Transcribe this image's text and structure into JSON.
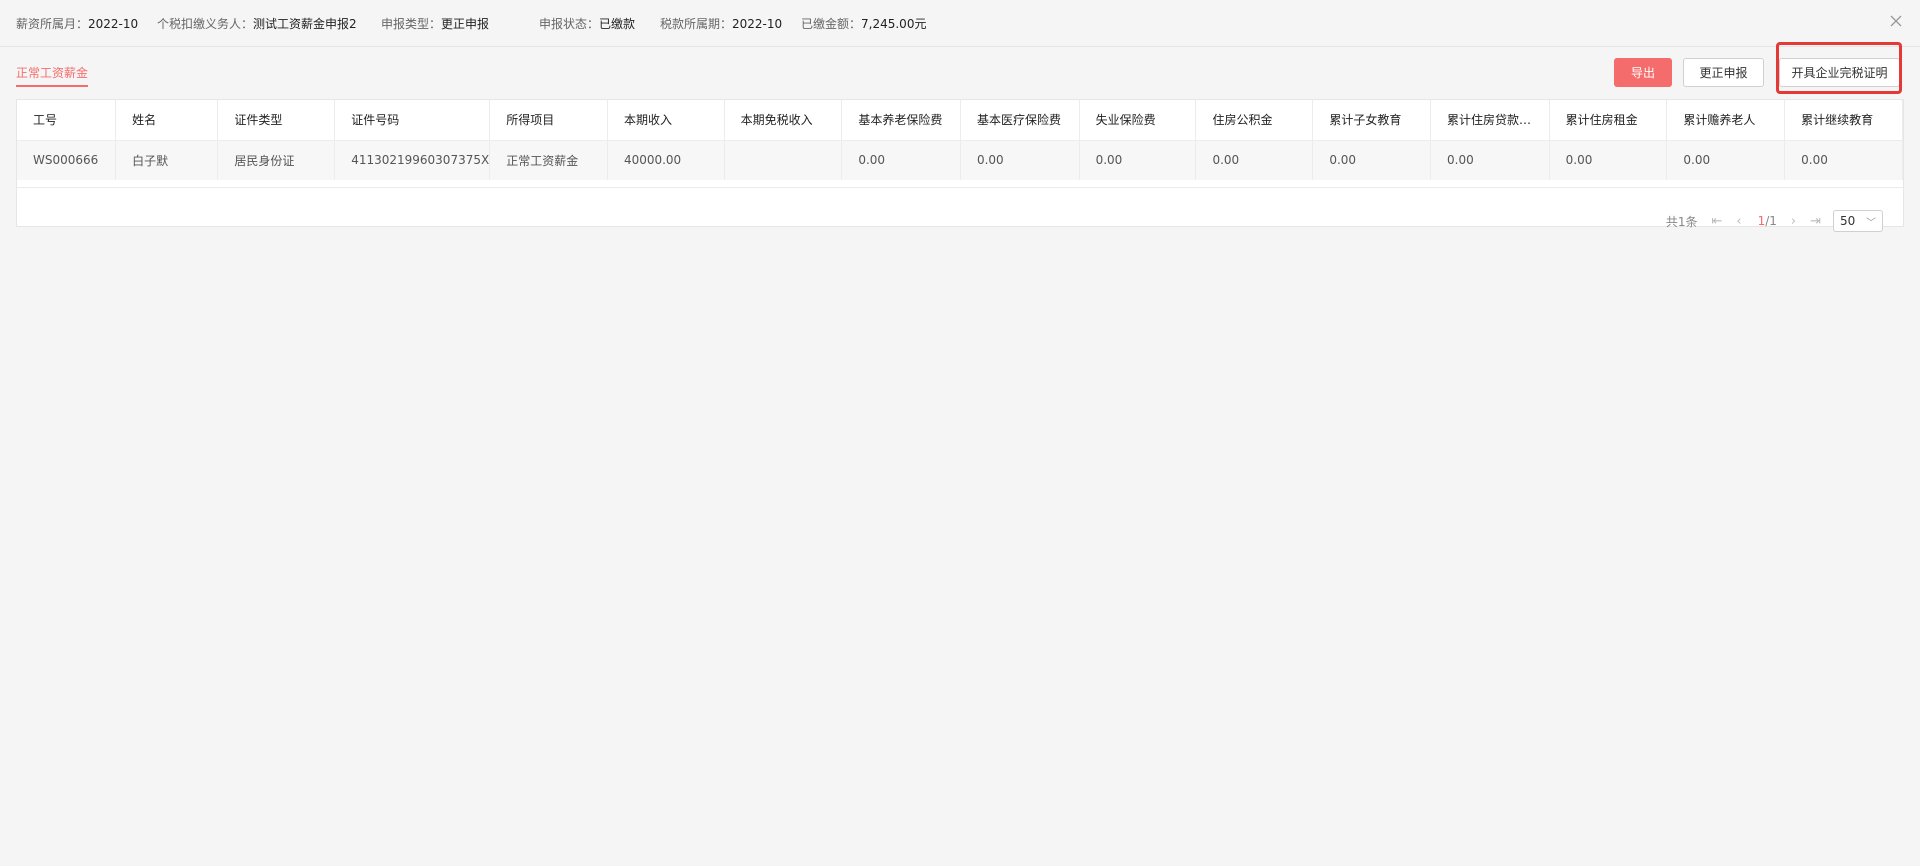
{
  "header": {
    "meta": [
      {
        "key": "薪资所属月：",
        "value": "2022-10"
      },
      {
        "key": "个税扣缴义务人：",
        "value": "测试工资薪金申报2"
      },
      {
        "key": "申报类型：",
        "value": "更正申报"
      },
      {
        "key": "申报状态：",
        "value": "已缴款"
      },
      {
        "key": "税款所属期：",
        "value": "2022-10"
      },
      {
        "key": "已缴金额：",
        "value": "7,245.00元"
      }
    ],
    "close_icon": "close-icon"
  },
  "tab": {
    "label": "正常工资薪金"
  },
  "toolbar": {
    "export_label": "导出",
    "correct_label": "更正申报",
    "certificate_label": "开具企业完税证明"
  },
  "colors": {
    "accent": "#f56c6c",
    "highlight": "#e53935"
  },
  "table": {
    "columns": [
      "工号",
      "姓名",
      "证件类型",
      "证件号码",
      "所得项目",
      "本期收入",
      "本期免税收入",
      "基本养老保险费",
      "基本医疗保险费",
      "失业保险费",
      "住房公积金",
      "累计子女教育",
      "累计住房贷款…",
      "累计住房租金",
      "累计赡养老人",
      "累计继续教育"
    ],
    "rows": [
      [
        "WS000666",
        "白子默",
        "居民身份证",
        "41130219960307375X",
        "正常工资薪金",
        "40000.00",
        "",
        "0.00",
        "0.00",
        "0.00",
        "0.00",
        "0.00",
        "0.00",
        "0.00",
        "0.00",
        "0.00"
      ]
    ]
  },
  "pagination": {
    "total": "共1条",
    "current": "1",
    "pages": "/1",
    "page_size": "50"
  }
}
